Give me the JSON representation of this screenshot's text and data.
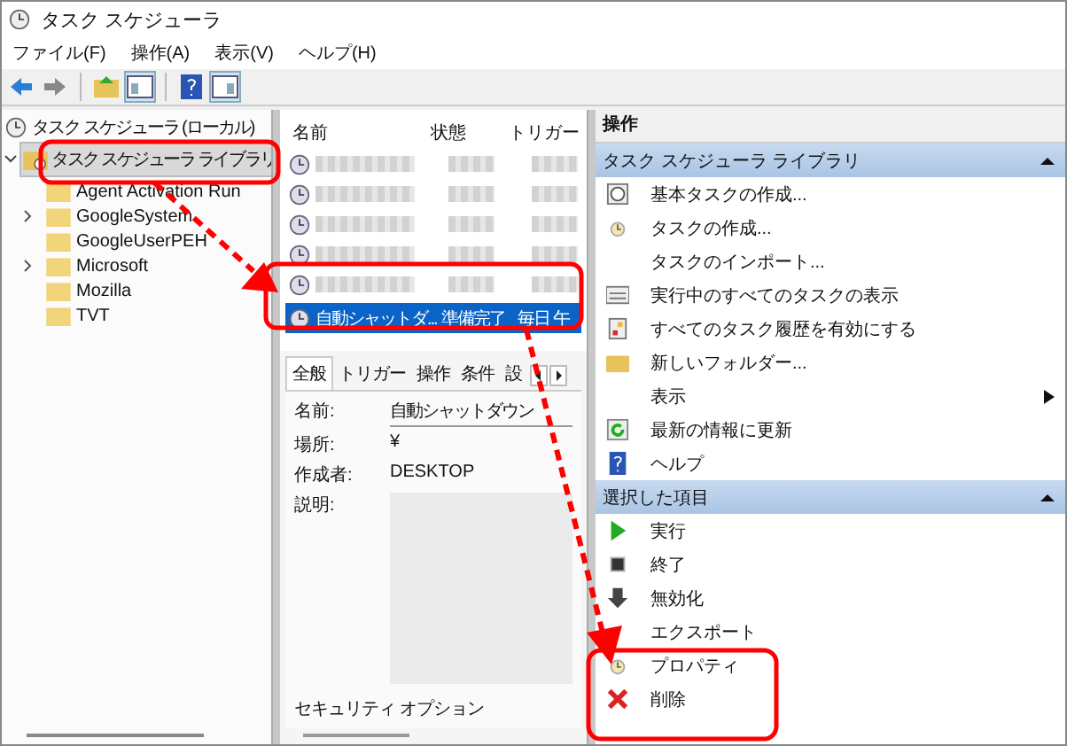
{
  "window": {
    "title": "タスク スケジューラ"
  },
  "menu": [
    "ファイル(F)",
    "操作(A)",
    "表示(V)",
    "ヘルプ(H)"
  ],
  "tree": {
    "root": "タスク スケジューラ (ローカル)",
    "children": [
      {
        "label": "タスク スケジューラ ライブラリ",
        "selected": true,
        "children": [
          {
            "label": "Agent Activation Run",
            "expandable": false
          },
          {
            "label": "GoogleSystem",
            "expandable": true
          },
          {
            "label": "GoogleUserPEH",
            "expandable": false
          },
          {
            "label": "Microsoft",
            "expandable": true
          },
          {
            "label": "Mozilla",
            "expandable": false
          },
          {
            "label": "TVT",
            "expandable": false
          }
        ]
      }
    ]
  },
  "task_list": {
    "columns": [
      "名前",
      "状態",
      "トリガー"
    ],
    "rows": [
      {
        "blurred": true,
        "selected": false
      },
      {
        "blurred": true,
        "selected": false
      },
      {
        "blurred": true,
        "selected": false
      },
      {
        "blurred": true,
        "selected": false
      },
      {
        "blurred": true,
        "selected": false
      },
      {
        "blurred": false,
        "selected": true,
        "cells": [
          "自動シャットダ...",
          "準備完了",
          "毎日 午"
        ]
      }
    ]
  },
  "detail": {
    "tabs": [
      {
        "label": "全般",
        "selected": true
      },
      {
        "label": "トリガー",
        "selected": false
      },
      {
        "label": "操作",
        "selected": false
      },
      {
        "label": "条件",
        "selected": false
      },
      {
        "label": "設",
        "selected": false
      }
    ],
    "fields": [
      {
        "label": "名前:",
        "kind": "box",
        "value": "自動シャットダウン"
      },
      {
        "label": "場所:",
        "kind": "text",
        "value": "¥"
      },
      {
        "label": "作成者:",
        "kind": "text",
        "value": "DESKTOP"
      },
      {
        "label": "説明:",
        "kind": "area"
      }
    ],
    "security": "セキュリティ オプション"
  },
  "actions": {
    "title": "操作",
    "sections": [
      {
        "title": "タスク スケジューラ ライブラリ",
        "expanded": true,
        "items": [
          {
            "label": "基本タスクの作成...",
            "kind": "clock"
          },
          {
            "label": "タスクの作成...",
            "kind": "task"
          },
          {
            "label": "タスクのインポート...",
            "kind": "plain"
          },
          {
            "label": "実行中のすべてのタスクの表示",
            "kind": "list"
          },
          {
            "label": "すべてのタスク履歴を有効にする",
            "kind": "history"
          },
          {
            "label": "新しいフォルダー...",
            "kind": "folder"
          },
          {
            "label": "表示",
            "kind": "submenu"
          },
          {
            "label": "最新の情報に更新",
            "kind": "refresh"
          },
          {
            "label": "ヘルプ",
            "kind": "help"
          }
        ]
      },
      {
        "title": "選択した項目",
        "expanded": true,
        "items": [
          {
            "label": "実行",
            "kind": "run"
          },
          {
            "label": "終了",
            "kind": "stop"
          },
          {
            "label": "無効化",
            "kind": "disable"
          },
          {
            "label": "エクスポート",
            "kind": "plain"
          },
          {
            "label": "プロパティ",
            "kind": "task"
          },
          {
            "label": "削除",
            "kind": "delete"
          }
        ]
      }
    ]
  }
}
